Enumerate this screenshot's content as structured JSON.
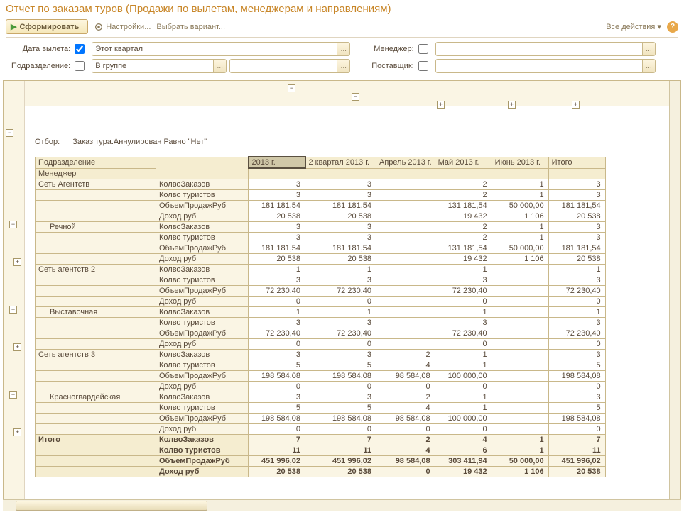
{
  "title": "Отчет по заказам туров (Продажи по вылетам, менеджерам и направлениям)",
  "toolbar": {
    "generate": "Сформировать",
    "settings": "Настройки...",
    "variant": "Выбрать вариант...",
    "all_actions": "Все действия",
    "help": "?"
  },
  "filters": {
    "flight_date_label": "Дата вылета:",
    "flight_date_value": "Этот квартал",
    "manager_label": "Менеджер:",
    "division_label": "Подразделение:",
    "division_value": "В группе",
    "supplier_label": "Поставщик:"
  },
  "report": {
    "filter_label": "Отбор:",
    "filter_text": "Заказ тура.Аннулирован Равно \"Нет\"",
    "headers": {
      "division": "Подразделение",
      "manager": "Менеджер",
      "year": "2013 г.",
      "q2": "2 квартал 2013 г.",
      "apr": "Апрель 2013 г.",
      "may": "Май 2013 г.",
      "jun": "Июнь 2013 г.",
      "total": "Итого"
    },
    "metrics": [
      "КолвоЗаказов",
      "Колво туристов",
      "ОбъемПродажРуб",
      "Доход руб"
    ],
    "groups": [
      {
        "name": "Сеть Агентств",
        "rows": [
          [
            "3",
            "3",
            "",
            "2",
            "1",
            "3"
          ],
          [
            "3",
            "3",
            "",
            "2",
            "1",
            "3"
          ],
          [
            "181 181,54",
            "181 181,54",
            "",
            "131 181,54",
            "50 000,00",
            "181 181,54"
          ],
          [
            "20 538",
            "20 538",
            "",
            "19 432",
            "1 106",
            "20 538"
          ]
        ],
        "children": [
          {
            "name": "Речной",
            "rows": [
              [
                "3",
                "3",
                "",
                "2",
                "1",
                "3"
              ],
              [
                "3",
                "3",
                "",
                "2",
                "1",
                "3"
              ],
              [
                "181 181,54",
                "181 181,54",
                "",
                "131 181,54",
                "50 000,00",
                "181 181,54"
              ],
              [
                "20 538",
                "20 538",
                "",
                "19 432",
                "1 106",
                "20 538"
              ]
            ]
          }
        ]
      },
      {
        "name": "Сеть агентств 2",
        "rows": [
          [
            "1",
            "1",
            "",
            "1",
            "",
            "1"
          ],
          [
            "3",
            "3",
            "",
            "3",
            "",
            "3"
          ],
          [
            "72 230,40",
            "72 230,40",
            "",
            "72 230,40",
            "",
            "72 230,40"
          ],
          [
            "0",
            "0",
            "",
            "0",
            "",
            "0"
          ]
        ],
        "children": [
          {
            "name": "Выставочная",
            "rows": [
              [
                "1",
                "1",
                "",
                "1",
                "",
                "1"
              ],
              [
                "3",
                "3",
                "",
                "3",
                "",
                "3"
              ],
              [
                "72 230,40",
                "72 230,40",
                "",
                "72 230,40",
                "",
                "72 230,40"
              ],
              [
                "0",
                "0",
                "",
                "0",
                "",
                "0"
              ]
            ]
          }
        ]
      },
      {
        "name": "Сеть агентств 3",
        "rows": [
          [
            "3",
            "3",
            "2",
            "1",
            "",
            "3"
          ],
          [
            "5",
            "5",
            "4",
            "1",
            "",
            "5"
          ],
          [
            "198 584,08",
            "198 584,08",
            "98 584,08",
            "100 000,00",
            "",
            "198 584,08"
          ],
          [
            "0",
            "0",
            "0",
            "0",
            "",
            "0"
          ]
        ],
        "children": [
          {
            "name": "Красногвардейская",
            "rows": [
              [
                "3",
                "3",
                "2",
                "1",
                "",
                "3"
              ],
              [
                "5",
                "5",
                "4",
                "1",
                "",
                "5"
              ],
              [
                "198 584,08",
                "198 584,08",
                "98 584,08",
                "100 000,00",
                "",
                "198 584,08"
              ],
              [
                "0",
                "0",
                "0",
                "0",
                "",
                "0"
              ]
            ]
          }
        ]
      }
    ],
    "totals": {
      "label": "Итого",
      "rows": [
        [
          "7",
          "7",
          "2",
          "4",
          "1",
          "7"
        ],
        [
          "11",
          "11",
          "4",
          "6",
          "1",
          "11"
        ],
        [
          "451 996,02",
          "451 996,02",
          "98 584,08",
          "303 411,94",
          "50 000,00",
          "451 996,02"
        ],
        [
          "20 538",
          "20 538",
          "0",
          "19 432",
          "1 106",
          "20 538"
        ]
      ]
    }
  }
}
